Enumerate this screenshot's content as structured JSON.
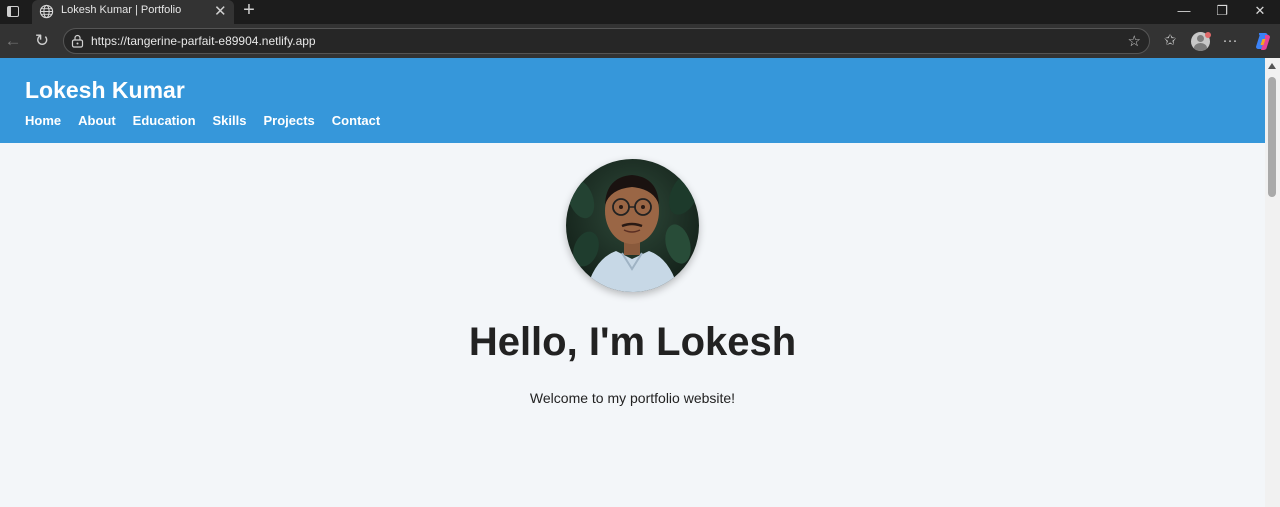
{
  "browser": {
    "tab": {
      "title": "Lokesh Kumar | Portfolio",
      "icon": "globe-icon"
    },
    "url": "https://tangerine-parfait-e89904.netlify.app"
  },
  "site": {
    "brand": "Lokesh Kumar",
    "nav": [
      {
        "label": "Home"
      },
      {
        "label": "About"
      },
      {
        "label": "Education"
      },
      {
        "label": "Skills"
      },
      {
        "label": "Projects"
      },
      {
        "label": "Contact"
      }
    ],
    "hero": {
      "heading": "Hello, I'm Lokesh",
      "tagline": "Welcome to my portfolio website!"
    }
  },
  "colors": {
    "header": "#3697da",
    "page_bg": "#f3f6f9",
    "text": "#222222"
  }
}
